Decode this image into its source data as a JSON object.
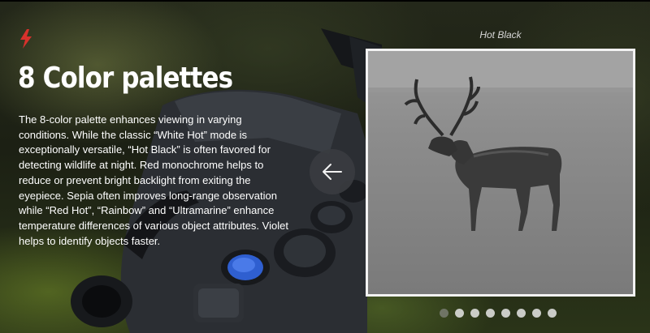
{
  "brand": {
    "icon": "lightning-bolt-icon",
    "accent_color": "#d7312c"
  },
  "headline": "8 Color palettes",
  "description": "The 8-color palette enhances viewing in varying conditions. While the classic “White Hot” mode is exceptionally versatile, “Hot Black” is often favored for detecting wildlife at night. Red monochrome helps to reduce or prevent bright backlight from exiting the eyepiece. Sepia often improves long-range observation while “Red Hot”, “Rainbow” and “Ultramarine” enhance temperature differences of various object attributes. Violet helps to identify objects faster.",
  "slider": {
    "current_caption": "Hot Black",
    "prev_button_icon": "arrow-left-icon",
    "slide_count": 8,
    "active_index": 0
  }
}
